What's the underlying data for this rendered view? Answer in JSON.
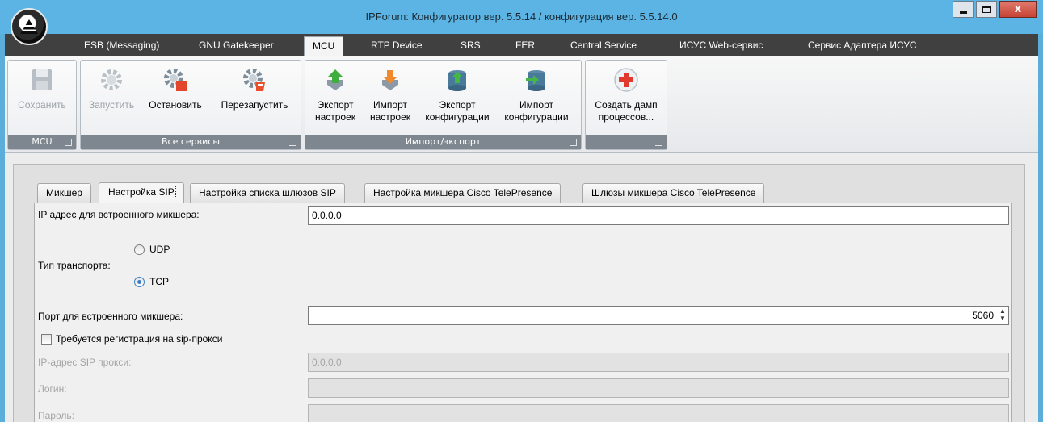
{
  "window": {
    "title": "IPForum: Конфигуратор вер. 5.5.14 / конфигурация вер. 5.5.14.0",
    "close_label": "x"
  },
  "menu": {
    "tabs": [
      {
        "label": "ESB (Messaging)"
      },
      {
        "label": "GNU Gatekeeper"
      },
      {
        "label": "MCU",
        "active": true
      },
      {
        "label": "RTP Device"
      },
      {
        "label": "SRS"
      },
      {
        "label": "FER"
      },
      {
        "label": "Central Service"
      },
      {
        "label": "ИСУС Web-сервис"
      },
      {
        "label": "Сервис Адаптера ИСУС"
      }
    ]
  },
  "ribbon": {
    "groups": [
      {
        "label": "MCU",
        "buttons": [
          {
            "label": "Сохранить",
            "icon": "save-icon",
            "enabled": false
          }
        ]
      },
      {
        "label": "Все сервисы",
        "buttons": [
          {
            "label": "Запустить",
            "icon": "start-gear-icon",
            "enabled": false
          },
          {
            "label": "Остановить",
            "icon": "stop-gear-icon",
            "enabled": true
          },
          {
            "label": "Перезапустить",
            "icon": "restart-gear-icon",
            "enabled": true
          }
        ]
      },
      {
        "label": "Импорт/экспорт",
        "buttons": [
          {
            "label1": "Экспорт",
            "label2": "настроек",
            "icon": "export-arrow-icon",
            "enabled": true
          },
          {
            "label1": "Импорт",
            "label2": "настроек",
            "icon": "import-arrow-icon",
            "enabled": true
          },
          {
            "label1": "Экспорт",
            "label2": "конфигурации",
            "icon": "export-db-icon",
            "enabled": true
          },
          {
            "label1": "Импорт",
            "label2": "конфигурации",
            "icon": "import-db-icon",
            "enabled": true
          }
        ]
      },
      {
        "label": "",
        "buttons": [
          {
            "label1": "Создать дамп",
            "label2": "процессов...",
            "icon": "medical-cross-icon",
            "enabled": true
          }
        ]
      }
    ],
    "colors": {
      "group_label_bg": "#7e8790"
    }
  },
  "tabs": [
    {
      "label": "Микшер"
    },
    {
      "label": "Настройка SIP",
      "active": true
    },
    {
      "label": "Настройка списка шлюзов SIP"
    },
    {
      "label": "Настройка микшера Cisco TelePresence"
    },
    {
      "label": "Шлюзы микшера Cisco TelePresence"
    }
  ],
  "form": {
    "ip_label": "IP адрес для встроенного микшера:",
    "ip_value": "0.0.0.0",
    "transport_label": "Тип транспорта:",
    "transport_options": [
      {
        "label": "UDP",
        "checked": false
      },
      {
        "label": "TCP",
        "checked": true
      }
    ],
    "port_label": "Порт для встроенного микшера:",
    "port_value": "5060",
    "registration_label": "Требуется регистрация на sip-прокси",
    "registration_checked": false,
    "proxy_ip_label": "IP-адрес SIP прокси:",
    "proxy_ip_value": "0.0.0.0",
    "login_label": "Логин:",
    "login_value": "",
    "password_label": "Пароль:",
    "password_value": ""
  }
}
